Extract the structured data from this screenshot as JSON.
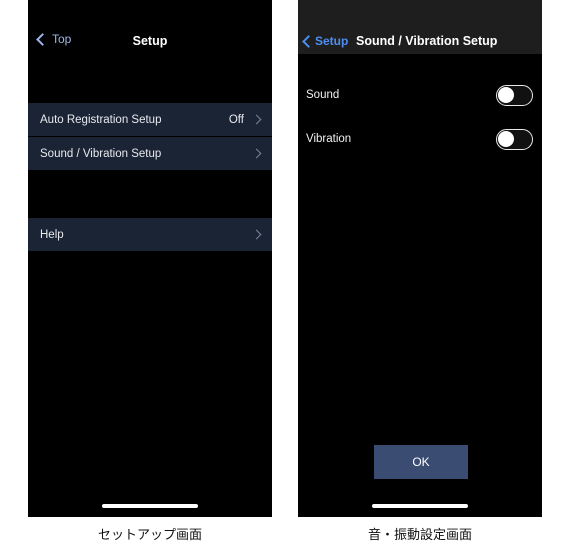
{
  "left_screen": {
    "caption": "セットアップ画面",
    "nav": {
      "back_label": "Top",
      "back_icon": "chevron-left-icon",
      "title": "Setup"
    },
    "rows": [
      {
        "label": "Auto Registration Setup",
        "value": "Off",
        "accessory": "chevron-right-icon"
      },
      {
        "label": "Sound / Vibration Setup",
        "value": "",
        "accessory": "chevron-right-icon"
      },
      {
        "label": "Help",
        "value": "",
        "accessory": "chevron-right-icon"
      }
    ]
  },
  "right_screen": {
    "caption": "音・振動設定画面",
    "nav": {
      "back_label": "Setup",
      "back_icon": "chevron-left-icon",
      "title": "Sound / Vibration Setup"
    },
    "toggles": [
      {
        "label": "Sound",
        "state": "off"
      },
      {
        "label": "Vibration",
        "state": "off"
      }
    ],
    "ok_label": "OK"
  },
  "colors": {
    "screen_background": "#000000",
    "header_background_right": "#1e1e1e",
    "list_row_background": "#1b2435",
    "link_blue_left": "#9fb6e8",
    "link_blue_right": "#4d8ff0",
    "ok_button": "#3a4c72",
    "text_primary": "#ffffff"
  }
}
